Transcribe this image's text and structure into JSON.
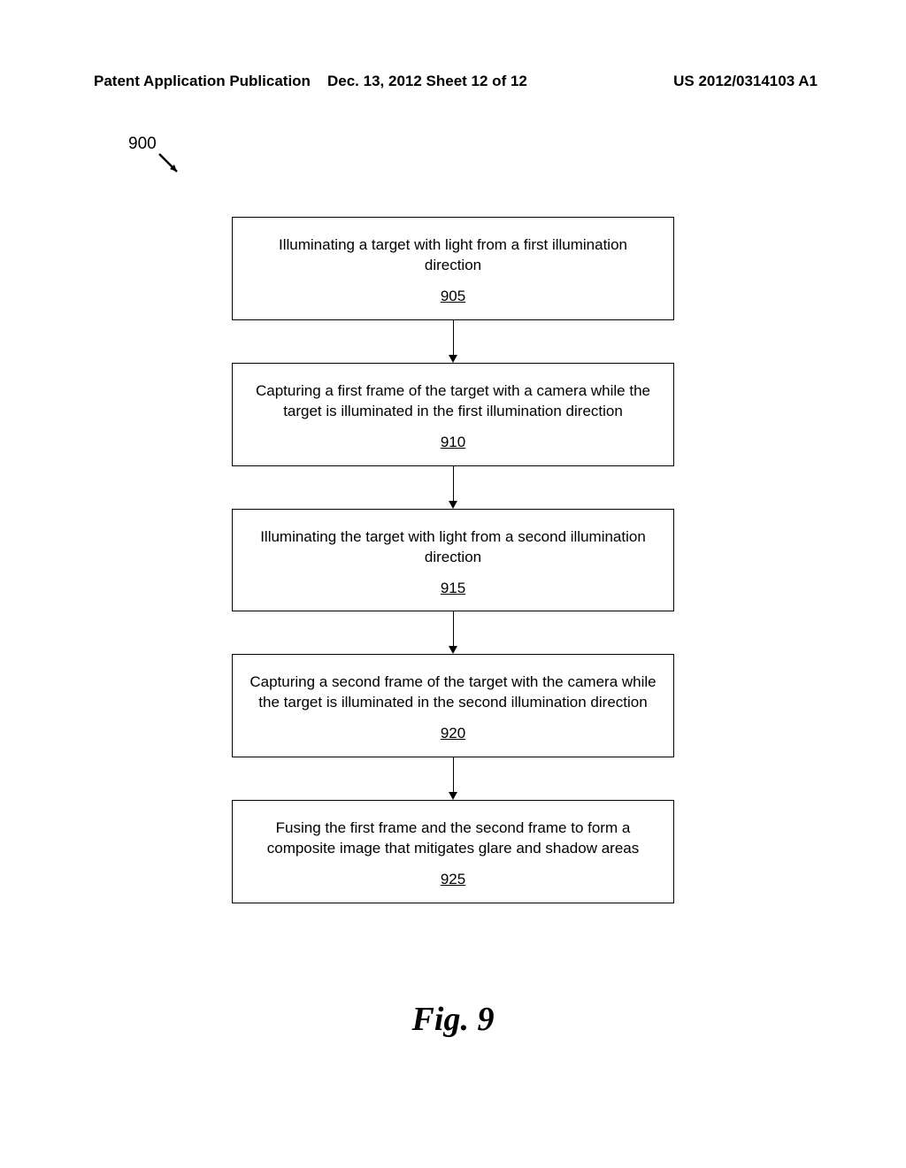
{
  "header": {
    "left": "Patent Application Publication",
    "center": "Dec. 13, 2012  Sheet 12 of 12",
    "right": "US 2012/0314103 A1"
  },
  "reference_label": "900",
  "steps": [
    {
      "text": "Illuminating a target with light from a first illumination direction",
      "number": "905"
    },
    {
      "text": "Capturing a first frame of the target with a camera while the target is illuminated in the first illumination direction",
      "number": "910"
    },
    {
      "text": "Illuminating the target with light from a second illumination direction",
      "number": "915"
    },
    {
      "text": "Capturing a second frame of the target with the camera while the target is illuminated in the second illumination direction",
      "number": "920"
    },
    {
      "text": "Fusing the first frame and the second frame to form a composite image that mitigates glare and shadow areas",
      "number": "925"
    }
  ],
  "figure_label": "Fig. 9"
}
